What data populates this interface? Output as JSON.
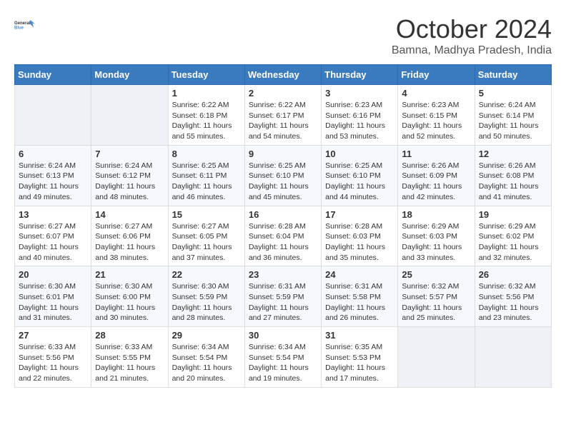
{
  "logo": {
    "line1": "General",
    "line2": "Blue"
  },
  "title": "October 2024",
  "location": "Bamna, Madhya Pradesh, India",
  "days_header": [
    "Sunday",
    "Monday",
    "Tuesday",
    "Wednesday",
    "Thursday",
    "Friday",
    "Saturday"
  ],
  "weeks": [
    [
      {
        "day": "",
        "info": ""
      },
      {
        "day": "",
        "info": ""
      },
      {
        "day": "1",
        "info": "Sunrise: 6:22 AM\nSunset: 6:18 PM\nDaylight: 11 hours and 55 minutes."
      },
      {
        "day": "2",
        "info": "Sunrise: 6:22 AM\nSunset: 6:17 PM\nDaylight: 11 hours and 54 minutes."
      },
      {
        "day": "3",
        "info": "Sunrise: 6:23 AM\nSunset: 6:16 PM\nDaylight: 11 hours and 53 minutes."
      },
      {
        "day": "4",
        "info": "Sunrise: 6:23 AM\nSunset: 6:15 PM\nDaylight: 11 hours and 52 minutes."
      },
      {
        "day": "5",
        "info": "Sunrise: 6:24 AM\nSunset: 6:14 PM\nDaylight: 11 hours and 50 minutes."
      }
    ],
    [
      {
        "day": "6",
        "info": "Sunrise: 6:24 AM\nSunset: 6:13 PM\nDaylight: 11 hours and 49 minutes."
      },
      {
        "day": "7",
        "info": "Sunrise: 6:24 AM\nSunset: 6:12 PM\nDaylight: 11 hours and 48 minutes."
      },
      {
        "day": "8",
        "info": "Sunrise: 6:25 AM\nSunset: 6:11 PM\nDaylight: 11 hours and 46 minutes."
      },
      {
        "day": "9",
        "info": "Sunrise: 6:25 AM\nSunset: 6:10 PM\nDaylight: 11 hours and 45 minutes."
      },
      {
        "day": "10",
        "info": "Sunrise: 6:25 AM\nSunset: 6:10 PM\nDaylight: 11 hours and 44 minutes."
      },
      {
        "day": "11",
        "info": "Sunrise: 6:26 AM\nSunset: 6:09 PM\nDaylight: 11 hours and 42 minutes."
      },
      {
        "day": "12",
        "info": "Sunrise: 6:26 AM\nSunset: 6:08 PM\nDaylight: 11 hours and 41 minutes."
      }
    ],
    [
      {
        "day": "13",
        "info": "Sunrise: 6:27 AM\nSunset: 6:07 PM\nDaylight: 11 hours and 40 minutes."
      },
      {
        "day": "14",
        "info": "Sunrise: 6:27 AM\nSunset: 6:06 PM\nDaylight: 11 hours and 38 minutes."
      },
      {
        "day": "15",
        "info": "Sunrise: 6:27 AM\nSunset: 6:05 PM\nDaylight: 11 hours and 37 minutes."
      },
      {
        "day": "16",
        "info": "Sunrise: 6:28 AM\nSunset: 6:04 PM\nDaylight: 11 hours and 36 minutes."
      },
      {
        "day": "17",
        "info": "Sunrise: 6:28 AM\nSunset: 6:03 PM\nDaylight: 11 hours and 35 minutes."
      },
      {
        "day": "18",
        "info": "Sunrise: 6:29 AM\nSunset: 6:03 PM\nDaylight: 11 hours and 33 minutes."
      },
      {
        "day": "19",
        "info": "Sunrise: 6:29 AM\nSunset: 6:02 PM\nDaylight: 11 hours and 32 minutes."
      }
    ],
    [
      {
        "day": "20",
        "info": "Sunrise: 6:30 AM\nSunset: 6:01 PM\nDaylight: 11 hours and 31 minutes."
      },
      {
        "day": "21",
        "info": "Sunrise: 6:30 AM\nSunset: 6:00 PM\nDaylight: 11 hours and 30 minutes."
      },
      {
        "day": "22",
        "info": "Sunrise: 6:30 AM\nSunset: 5:59 PM\nDaylight: 11 hours and 28 minutes."
      },
      {
        "day": "23",
        "info": "Sunrise: 6:31 AM\nSunset: 5:59 PM\nDaylight: 11 hours and 27 minutes."
      },
      {
        "day": "24",
        "info": "Sunrise: 6:31 AM\nSunset: 5:58 PM\nDaylight: 11 hours and 26 minutes."
      },
      {
        "day": "25",
        "info": "Sunrise: 6:32 AM\nSunset: 5:57 PM\nDaylight: 11 hours and 25 minutes."
      },
      {
        "day": "26",
        "info": "Sunrise: 6:32 AM\nSunset: 5:56 PM\nDaylight: 11 hours and 23 minutes."
      }
    ],
    [
      {
        "day": "27",
        "info": "Sunrise: 6:33 AM\nSunset: 5:56 PM\nDaylight: 11 hours and 22 minutes."
      },
      {
        "day": "28",
        "info": "Sunrise: 6:33 AM\nSunset: 5:55 PM\nDaylight: 11 hours and 21 minutes."
      },
      {
        "day": "29",
        "info": "Sunrise: 6:34 AM\nSunset: 5:54 PM\nDaylight: 11 hours and 20 minutes."
      },
      {
        "day": "30",
        "info": "Sunrise: 6:34 AM\nSunset: 5:54 PM\nDaylight: 11 hours and 19 minutes."
      },
      {
        "day": "31",
        "info": "Sunrise: 6:35 AM\nSunset: 5:53 PM\nDaylight: 11 hours and 17 minutes."
      },
      {
        "day": "",
        "info": ""
      },
      {
        "day": "",
        "info": ""
      }
    ]
  ]
}
